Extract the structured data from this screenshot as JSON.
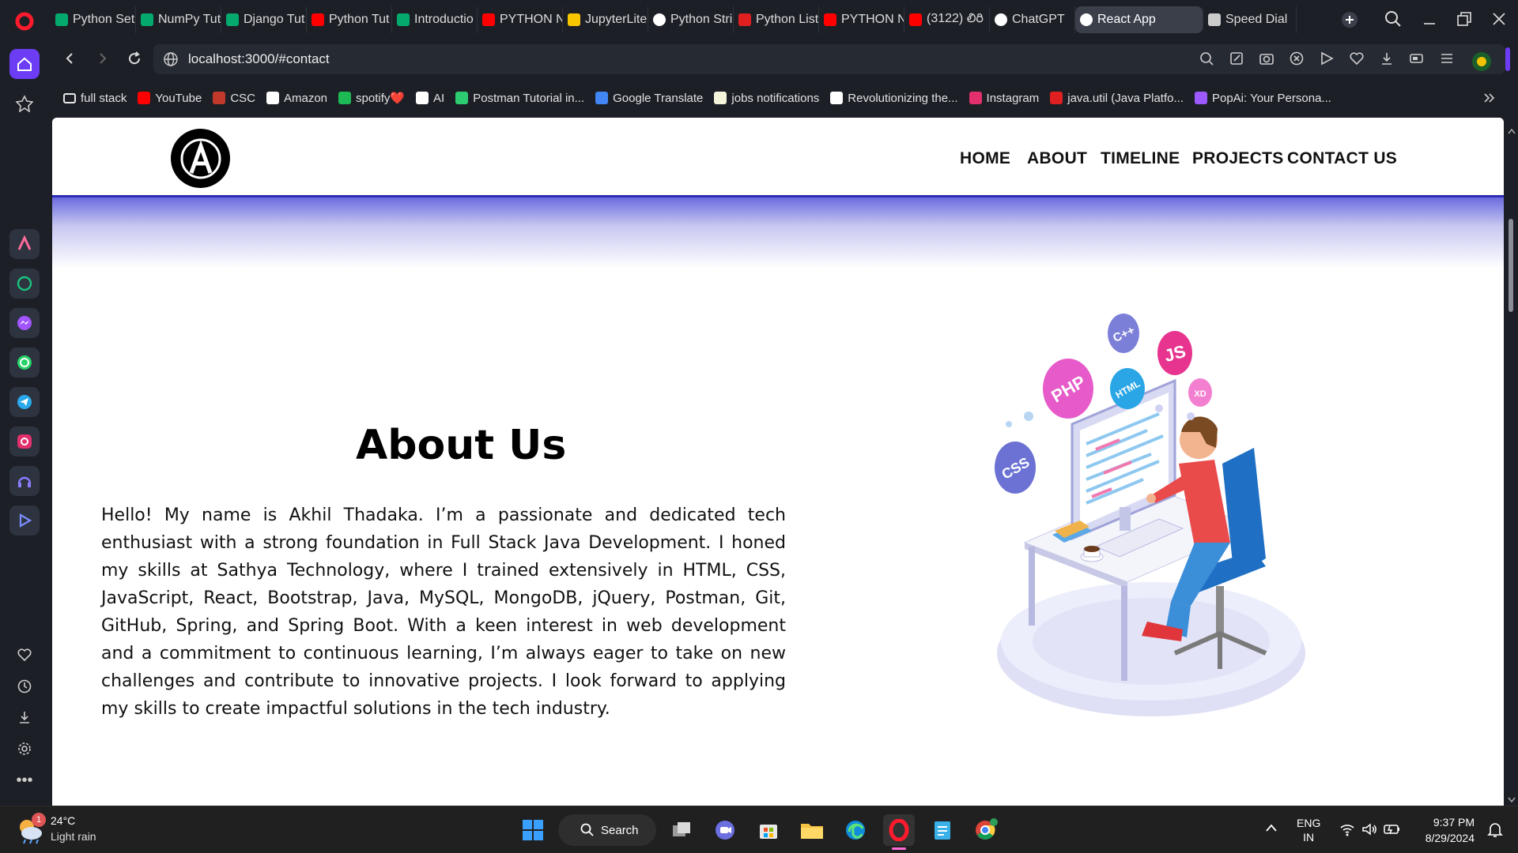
{
  "browser": {
    "tabs": [
      {
        "label": "Python Set",
        "icon": "w3schools-icon",
        "color": "#04aa6d"
      },
      {
        "label": "NumPy Tut",
        "icon": "w3schools-icon",
        "color": "#04aa6d"
      },
      {
        "label": "Django Tut",
        "icon": "w3schools-icon",
        "color": "#04aa6d"
      },
      {
        "label": "Python Tut",
        "icon": "youtube-icon",
        "color": "#ff0000"
      },
      {
        "label": "Introductio",
        "icon": "w3schools-icon",
        "color": "#04aa6d"
      },
      {
        "label": "PYTHON N",
        "icon": "youtube-icon",
        "color": "#ff0000"
      },
      {
        "label": "JupyterLite",
        "icon": "jupyter-icon",
        "color": "#f7c600"
      },
      {
        "label": "Python Stri",
        "icon": "chatgpt-icon",
        "color": "#ffffff"
      },
      {
        "label": "Python List",
        "icon": "vercel-icon",
        "color": "#e02020"
      },
      {
        "label": "PYTHON N",
        "icon": "youtube-icon",
        "color": "#ff0000"
      },
      {
        "label": "(3122) లిరి",
        "icon": "youtube-icon",
        "color": "#ff0000"
      },
      {
        "label": "ChatGPT",
        "icon": "chatgpt-icon",
        "color": "#ffffff"
      },
      {
        "label": "React App",
        "icon": "react-icon",
        "color": "#ffffff",
        "active": true
      },
      {
        "label": "Speed Dial",
        "icon": "grid-icon",
        "color": "#cccccc"
      }
    ],
    "url": "localhost:3000/#contact",
    "bookmarks": [
      {
        "label": "full stack",
        "icon": "folder-icon"
      },
      {
        "label": "YouTube",
        "icon": "youtube-icon"
      },
      {
        "label": "CSC",
        "icon": "csc-icon"
      },
      {
        "label": "Amazon",
        "icon": "amazon-icon"
      },
      {
        "label": "spotify❤️",
        "icon": "spotify-icon"
      },
      {
        "label": "AI",
        "icon": "chatgpt-icon"
      },
      {
        "label": "Postman Tutorial in...",
        "icon": "leaf-icon"
      },
      {
        "label": "Google Translate",
        "icon": "translate-icon"
      },
      {
        "label": "jobs notifications",
        "icon": "jobs-icon"
      },
      {
        "label": "Revolutionizing the...",
        "icon": "article-icon"
      },
      {
        "label": "Instagram",
        "icon": "instagram-icon"
      },
      {
        "label": "java.util (Java Platfo...",
        "icon": "oracle-icon"
      },
      {
        "label": "PopAi: Your Persona...",
        "icon": "popai-icon"
      }
    ]
  },
  "site": {
    "nav": [
      "HOME",
      "ABOUT",
      "TIMELINE",
      "PROJECTS",
      "CONTACT US"
    ],
    "about_title": "About Us",
    "about_text": "Hello! My name is Akhil Thadaka. I’m a passionate and dedicated tech enthusiast with a strong foundation in Full Stack Java Development. I honed my skills at Sathya Technology, where I trained extensively in HTML, CSS, JavaScript, React, Bootstrap, Java, MySQL, MongoDB, jQuery, Postman, Git, GitHub, Spring, and Spring Boot. With a keen interest in web development and a commitment to continuous learning, I’m always eager to take on new challenges and contribute to innovative projects. I look forward to applying my skills to create impactful solutions in the tech industry.",
    "illustration_bubbles": [
      "C++",
      "JS",
      "PHP",
      "HTML",
      "XD",
      "CSS"
    ]
  },
  "taskbar": {
    "weather_temp": "24°C",
    "weather_desc": "Light rain",
    "weather_badge": "1",
    "search_label": "Search",
    "lang_line1": "ENG",
    "lang_line2": "IN",
    "time": "9:37 PM",
    "date": "8/29/2024"
  }
}
